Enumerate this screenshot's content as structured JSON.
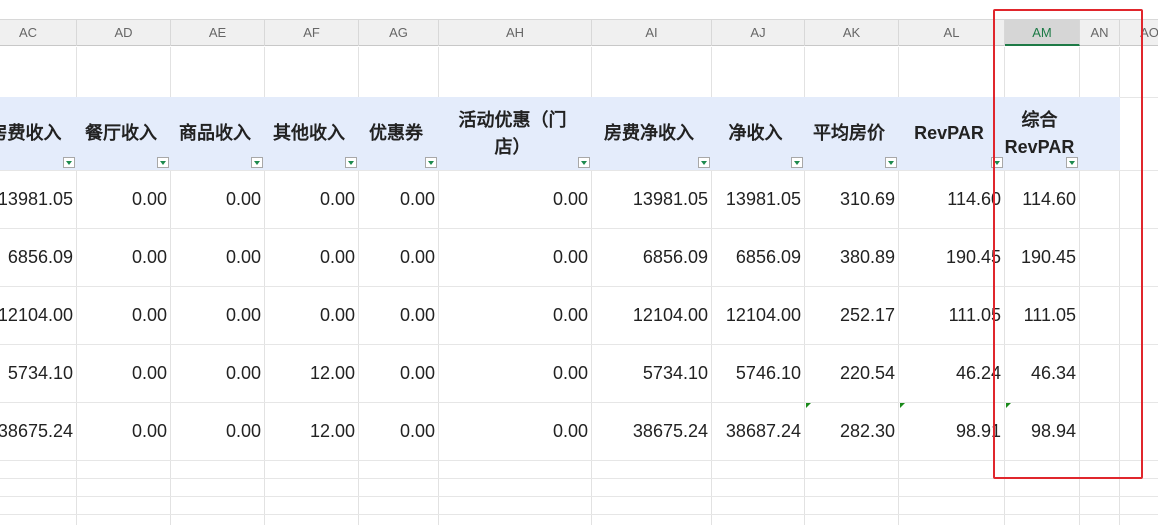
{
  "column_letters": [
    "AC",
    "AD",
    "AE",
    "AF",
    "AG",
    "AH",
    "AI",
    "AJ",
    "AK",
    "AL",
    "AM",
    "AN",
    "AO"
  ],
  "active_column": "AM",
  "headers": [
    "房费收入",
    "餐厅收入",
    "商品收入",
    "其他收入",
    "优惠券",
    "活动优惠（门\n店）",
    "房费净收入",
    "净收入",
    "平均房价",
    "RevPAR",
    "综合\nRevPAR"
  ],
  "rows": [
    [
      "13981.05",
      "0.00",
      "0.00",
      "0.00",
      "0.00",
      "0.00",
      "13981.05",
      "13981.05",
      "310.69",
      "114.60",
      "114.60"
    ],
    [
      "6856.09",
      "0.00",
      "0.00",
      "0.00",
      "0.00",
      "0.00",
      "6856.09",
      "6856.09",
      "380.89",
      "190.45",
      "190.45"
    ],
    [
      "12104.00",
      "0.00",
      "0.00",
      "0.00",
      "0.00",
      "0.00",
      "12104.00",
      "12104.00",
      "252.17",
      "111.05",
      "111.05"
    ],
    [
      "5734.10",
      "0.00",
      "0.00",
      "12.00",
      "0.00",
      "0.00",
      "5734.10",
      "5746.10",
      "220.54",
      "46.24",
      "46.34"
    ],
    [
      "38675.24",
      "0.00",
      "0.00",
      "12.00",
      "0.00",
      "0.00",
      "38675.24",
      "38687.24",
      "282.30",
      "98.91",
      "98.94"
    ]
  ],
  "colors": {
    "header_bg": "#e4ecfb",
    "highlight": "#e0262c",
    "active_column": "#1d7a46"
  }
}
